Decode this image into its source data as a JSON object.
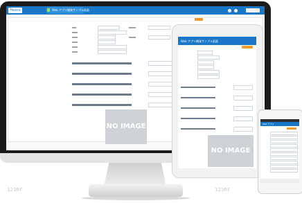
{
  "app": {
    "logo_text": "Hexco",
    "title": "Web アプリ開発サンプル画面",
    "tablet_title": "Web アプリ開発サンプル画面",
    "phone_title": "Web アプリ"
  },
  "placeholders": {
    "no_image": "NO IMAGE"
  },
  "watermark": {
    "text": "123RF"
  },
  "colors": {
    "accent": "#1877c8",
    "bezel": "#1b1b1c",
    "button": "#f09a2b"
  },
  "icons": [
    "pencil-icon",
    "info-icon",
    "home-icon",
    "user-icon"
  ]
}
